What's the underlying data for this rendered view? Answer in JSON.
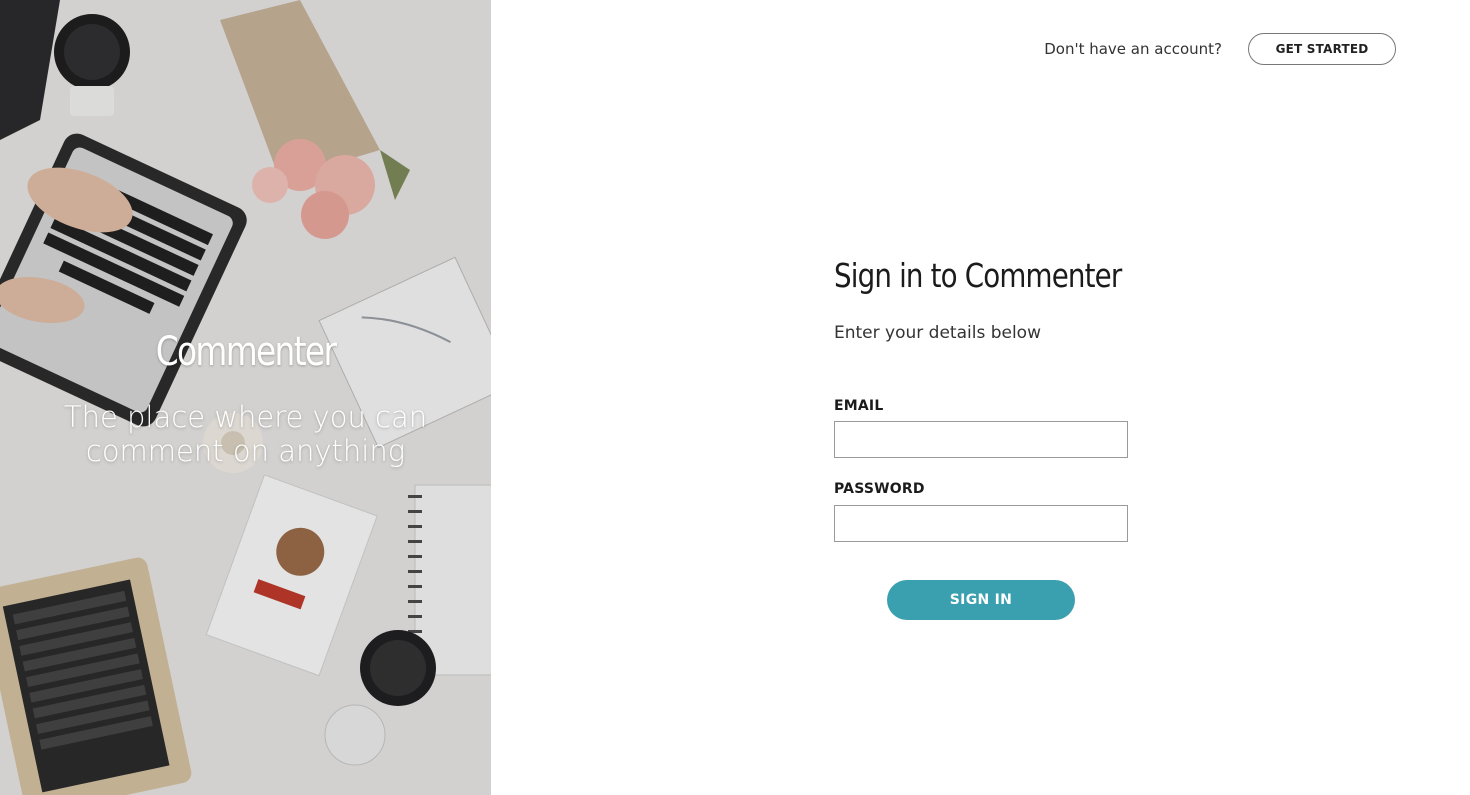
{
  "hero": {
    "title": "Commenter",
    "tagline": "The place where you can comment on anything",
    "image_description_icon": "desk-flatlay-image"
  },
  "topbar": {
    "prompt": "Don't have an account?",
    "get_started_label": "GET STARTED"
  },
  "form": {
    "title": "Sign in to Commenter",
    "subtitle": "Enter your details below",
    "email_label": "EMAIL",
    "email_value": "",
    "email_placeholder": "",
    "password_label": "PASSWORD",
    "password_value": "",
    "password_placeholder": "",
    "submit_label": "SIGN IN"
  },
  "colors": {
    "accent": "#3aa0b0",
    "text": "#1b1b1b",
    "muted": "#333333",
    "border": "#9a9a9a"
  }
}
